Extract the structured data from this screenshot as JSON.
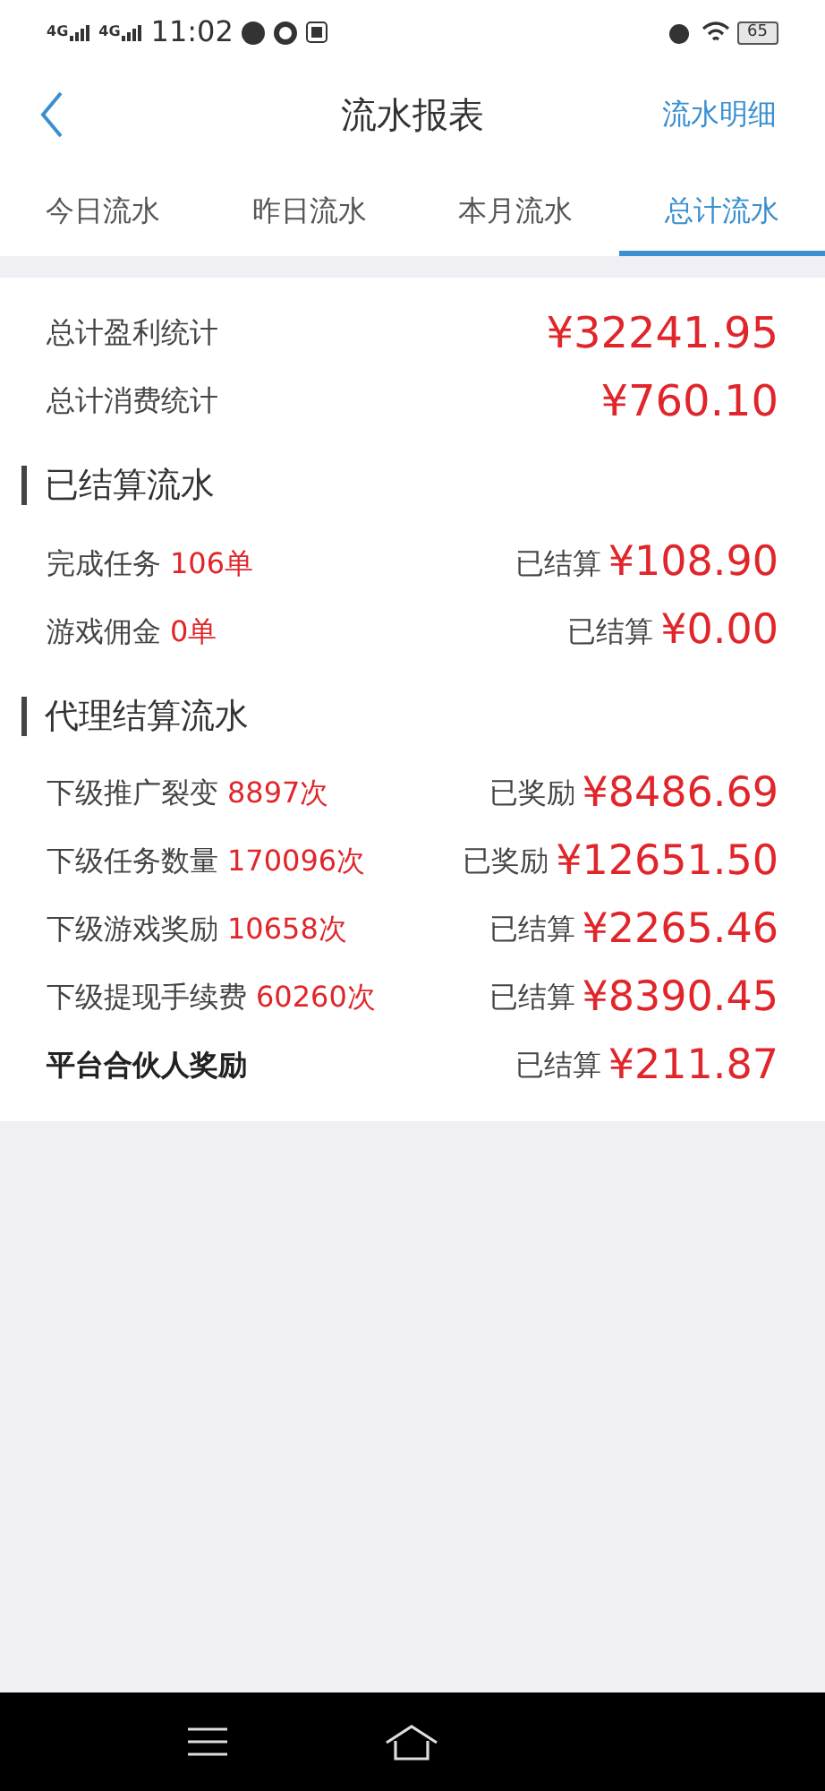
{
  "status_bar": {
    "signal_1": "4G",
    "signal_2": "4G",
    "time": "11:02",
    "battery": "65"
  },
  "header": {
    "title": "流水报表",
    "action": "流水明细"
  },
  "tabs": [
    {
      "label": "今日流水",
      "selected": false
    },
    {
      "label": "昨日流水",
      "selected": false
    },
    {
      "label": "本月流水",
      "selected": false
    },
    {
      "label": "总计流水",
      "selected": true
    }
  ],
  "totals": [
    {
      "label": "总计盈利统计",
      "amount": "¥32241.95"
    },
    {
      "label": "总计消费统计",
      "amount": "¥760.10"
    }
  ],
  "sections": [
    {
      "title": "已结算流水",
      "rows": [
        {
          "label": "完成任务",
          "count": "106单",
          "status": "已结算",
          "amount": "¥108.90",
          "bold": false
        },
        {
          "label": "游戏佣金",
          "count": "0单",
          "status": "已结算",
          "amount": "¥0.00",
          "bold": false
        }
      ]
    },
    {
      "title": "代理结算流水",
      "rows": [
        {
          "label": "下级推广裂变",
          "count": "8897次",
          "status": "已奖励",
          "amount": "¥8486.69",
          "bold": false
        },
        {
          "label": "下级任务数量",
          "count": "170096次",
          "status": "已奖励",
          "amount": "¥12651.50",
          "bold": false
        },
        {
          "label": "下级游戏奖励",
          "count": "10658次",
          "status": "已结算",
          "amount": "¥2265.46",
          "bold": false
        },
        {
          "label": "下级提现手续费",
          "count": "60260次",
          "status": "已结算",
          "amount": "¥8390.45",
          "bold": false
        },
        {
          "label": "平台合伙人奖励",
          "status": "已结算",
          "amount": "¥211.87",
          "bold": true
        }
      ]
    }
  ]
}
